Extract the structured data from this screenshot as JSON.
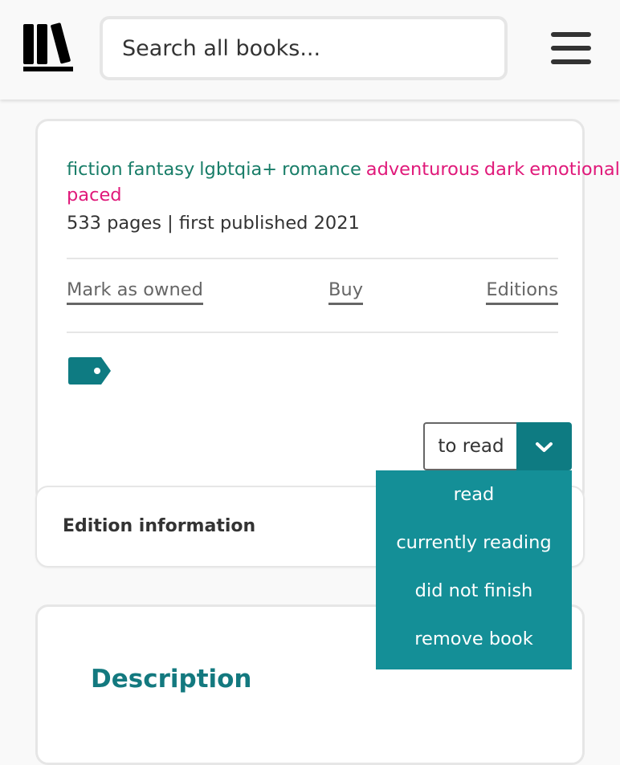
{
  "header": {
    "logo_icon": "bookshelf-icon",
    "search_placeholder": "Search all books...",
    "menu_icon": "hamburger-menu-icon"
  },
  "book": {
    "genre_tags": [
      "fiction",
      "fantasy",
      "lgbtqia+",
      "romance"
    ],
    "mood_tags": [
      "adventurous",
      "dark",
      "emotional",
      "medium-paced"
    ],
    "meta": "533 pages | first published 2021",
    "links": {
      "mark_owned": "Mark as owned",
      "buy": "Buy",
      "editions": "Editions"
    },
    "tag_icon": "tag-icon"
  },
  "status_select": {
    "current": "to read",
    "toggle_icon": "chevron-down-icon",
    "options": [
      "read",
      "currently reading",
      "did not finish",
      "remove book"
    ]
  },
  "edition_section": {
    "title": "Edition information"
  },
  "description_section": {
    "title": "Description"
  },
  "colors": {
    "genre_tag": "#187d68",
    "mood_tag": "#e0197a",
    "accent_teal": "#0e7b82",
    "dropdown_bg": "#148f97",
    "description_heading": "#13797f"
  }
}
